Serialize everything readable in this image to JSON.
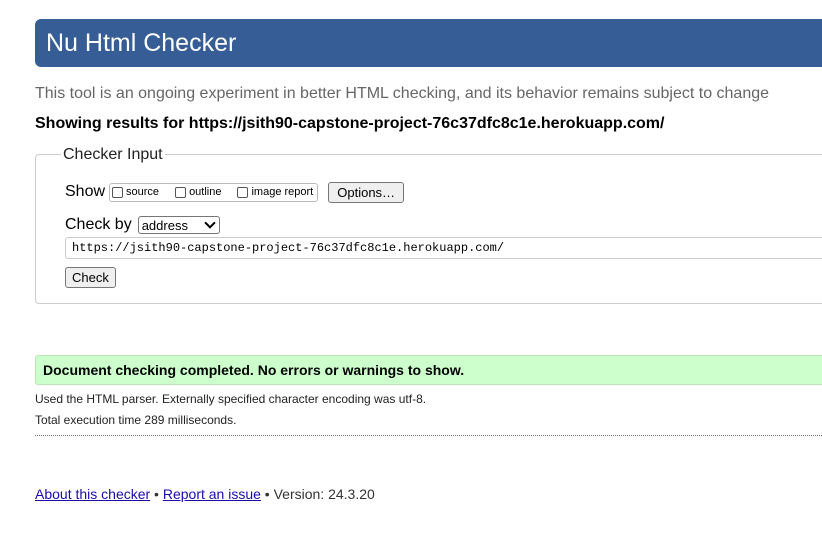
{
  "header": {
    "title": "Nu Html Checker"
  },
  "intro": "This tool is an ongoing experiment in better HTML checking, and its behavior remains subject to change",
  "results_heading": "Showing results for https://jsith90-capstone-project-76c37dfc8c1e.herokuapp.com/",
  "checker_input": {
    "legend": "Checker Input",
    "show_label": "Show",
    "options": {
      "source": "source",
      "outline": "outline",
      "image_report": "image report"
    },
    "options_button": "Options…",
    "check_by_label": "Check by",
    "check_by_selected": "address",
    "url_value": "https://jsith90-capstone-project-76c37dfc8c1e.herokuapp.com/",
    "check_button": "Check"
  },
  "result": {
    "success_message": "Document checking completed. No errors or warnings to show.",
    "parser_info": "Used the HTML parser. Externally specified character encoding was utf-8.",
    "execution_time": "Total execution time 289 milliseconds."
  },
  "footer": {
    "about_link": "About this checker",
    "separator": " • ",
    "report_link": "Report an issue",
    "version": " • Version: 24.3.20"
  },
  "colors": {
    "banner": "#365d95",
    "success_bg": "#ccffcc",
    "link": "#1a0dab"
  }
}
